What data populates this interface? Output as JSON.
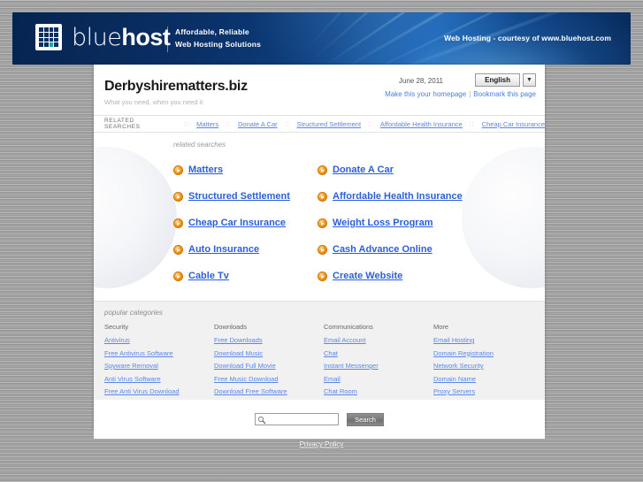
{
  "banner": {
    "logo_text_light": "blue",
    "logo_text_bold": "host",
    "tagline_line1": "Affordable, Reliable",
    "tagline_line2": "Web Hosting Solutions",
    "right_text": "Web Hosting - courtesy of www.bluehost.com",
    "brand_color": "#0a2f62",
    "accent_color": "#1aa6ae"
  },
  "header": {
    "site_title": "Derbyshirematters.biz",
    "site_subtitle": "What you need, when you need it",
    "date": "June 28, 2011",
    "language_value": "English",
    "language_arrow": "▼",
    "homepage_link": "Make this your homepage",
    "separator": "|",
    "bookmark_link": "Bookmark this page"
  },
  "related_nav": {
    "label": "RELATED SEARCHES",
    "dots": "::",
    "items": [
      "Matters",
      "Donate A Car",
      "Structured Settlement",
      "Affordable Health Insurance",
      "Cheap Car Insurance"
    ]
  },
  "related_searches": {
    "heading": "related searches",
    "links": [
      "Matters",
      "Donate A Car",
      "Structured Settlement",
      "Affordable Health Insurance",
      "Cheap Car Insurance",
      "Weight Loss Program",
      "Auto Insurance",
      "Cash Advance Online",
      "Cable Tv",
      "Create Website"
    ]
  },
  "popular_categories": {
    "heading": "popular categories",
    "columns": [
      {
        "title": "Security",
        "links": [
          "Antivirus",
          "Free Antivirus Software",
          "Spyware Removal",
          "Anti Virus Software",
          "Free Anti Virus Download"
        ]
      },
      {
        "title": "Downloads",
        "links": [
          "Free Downloads",
          "Download Music",
          "Download Full Movie",
          "Free Music Download",
          "Download Free Software"
        ]
      },
      {
        "title": "Communications",
        "links": [
          "Email Account",
          "Chat",
          "Instant Messenger",
          "Email",
          "Chat Room"
        ]
      },
      {
        "title": "More",
        "links": [
          "Email Hosting",
          "Domain Registration",
          "Network Security",
          "Domain Name",
          "Proxy Servers"
        ]
      }
    ]
  },
  "search": {
    "value": "",
    "placeholder": "",
    "button_label": "Search"
  },
  "footer": {
    "privacy_link": "Privacy Policy"
  }
}
